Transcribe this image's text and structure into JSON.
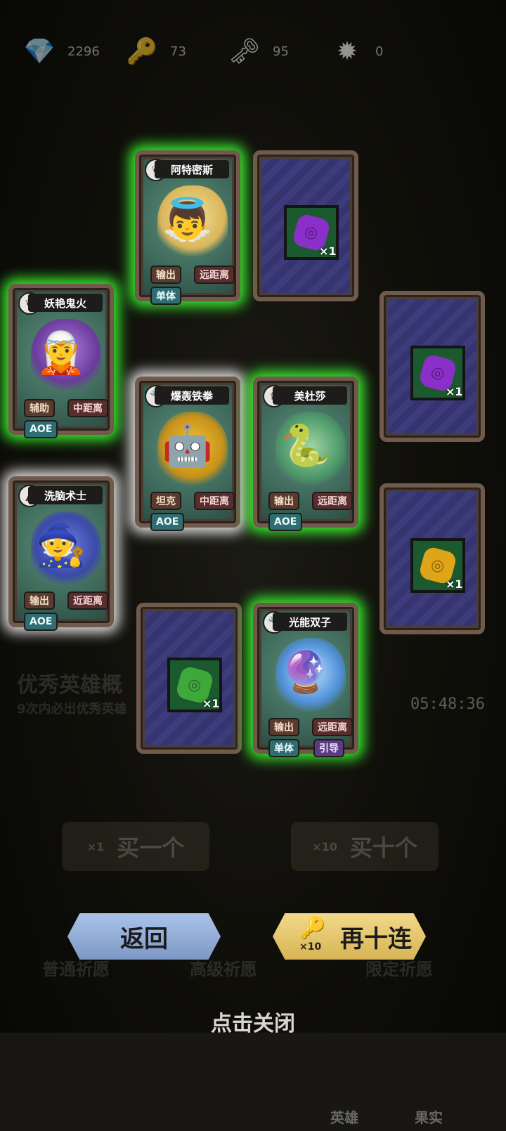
{
  "currency": [
    {
      "icon": "diamond-icon",
      "value": "2296"
    },
    {
      "icon": "silver-key-icon",
      "value": "73"
    },
    {
      "icon": "bronze-key-icon",
      "value": "95"
    },
    {
      "icon": "spiky-token-icon",
      "value": "0"
    }
  ],
  "background": {
    "banner_title": "优秀英雄概",
    "banner_sub": "9次内必出优秀英雄",
    "buy_one": "买一个",
    "buy_one_qty": "×1",
    "buy_ten": "买十个",
    "buy_ten_qty": "×10",
    "timer": "05:48:36",
    "tabs_bottom": [
      "普通祈愿",
      "高级祈愿",
      "限定祈愿"
    ],
    "nav": [
      "英雄",
      "果实"
    ]
  },
  "cards": {
    "hero1": {
      "name": "阿特密斯",
      "class_icon": "wing-icon",
      "tags": [
        "输出",
        "远距离",
        "单体"
      ]
    },
    "item1": {
      "gem_color": "#8a2fc8",
      "qty": "×1"
    },
    "hero2": {
      "name": "妖艳鬼火",
      "class_icon": "wing-icon",
      "tags": [
        "辅助",
        "中距离",
        "AOE"
      ]
    },
    "item2": {
      "gem_color": "#8a2fc8",
      "qty": "×1"
    },
    "hero3": {
      "name": "爆轰铁拳",
      "class_icon": "wrench-icon",
      "tags": [
        "坦克",
        "中距离",
        "AOE"
      ]
    },
    "hero4": {
      "name": "美杜莎",
      "class_icon": "crown-icon",
      "tags": [
        "输出",
        "远距离",
        "AOE"
      ]
    },
    "hero5": {
      "name": "洗脑术士",
      "class_icon": "flame-icon",
      "tags": [
        "输出",
        "近距离",
        "AOE"
      ]
    },
    "item3": {
      "gem_color": "#e0a418",
      "qty": "×1"
    },
    "item4": {
      "gem_color": "#3ea83a",
      "qty": "×1"
    },
    "hero6": {
      "name": "光能双子",
      "class_icon": "wrench-icon",
      "tags": [
        "输出",
        "远距离",
        "单体",
        "引导"
      ]
    }
  },
  "buttons": {
    "back": "返回",
    "ten_pull": "再十连",
    "ten_pull_cost": "×10"
  },
  "close_hint": "点击关闭"
}
